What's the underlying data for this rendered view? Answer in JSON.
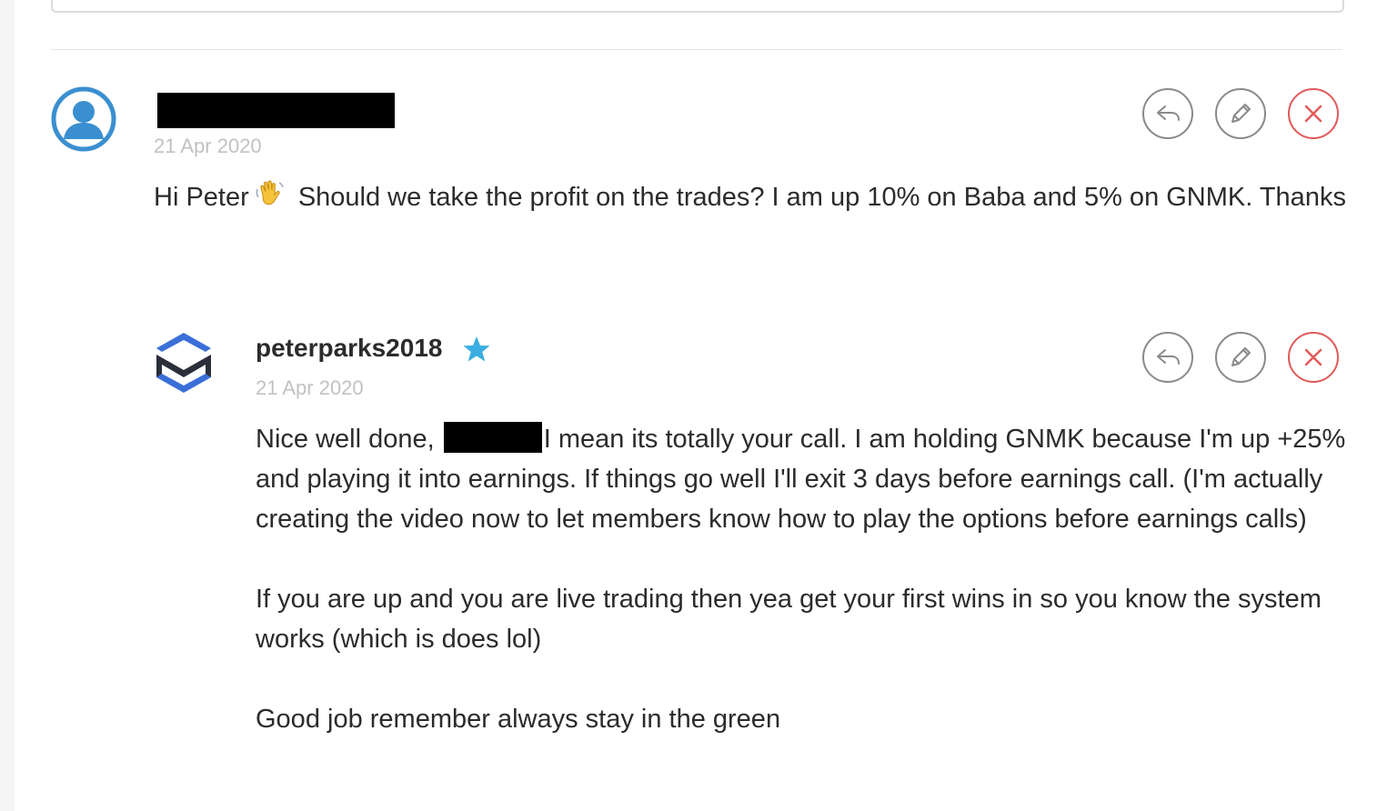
{
  "comments": [
    {
      "author": "",
      "date": "21 Apr 2020",
      "body_before_emoji": "Hi Peter",
      "body_after_emoji": "Should we take the profit on the trades? I am up 10% on Baba and 5% on GNMK. Thanks",
      "emoji": "waving-hand-icon"
    },
    {
      "author": "peterparks2018",
      "badge": "star-icon",
      "date": "21 Apr 2020",
      "para1_before": "Nice well done,",
      "para1_after": "I mean its totally your call. I am holding GNMK because I'm up +25% and playing it into earnings. If things go well I'll exit 3 days before earnings call. (I'm actually creating the video now to let members know how to play the options before earnings calls)",
      "para2": "If you are up and you are live trading then yea get your first wins in so you know the system works (which is does lol)",
      "para3": "Good job remember always stay in the green"
    }
  ],
  "actions": [
    "reply-icon",
    "edit-icon",
    "delete-icon"
  ],
  "colors": {
    "avatar_blue": "#3a8fd0",
    "delete_red": "#e25a5a",
    "star_blue": "#3aaee0",
    "brand_dark": "#2a2f3a",
    "brand_blue": "#3b6fd8"
  }
}
